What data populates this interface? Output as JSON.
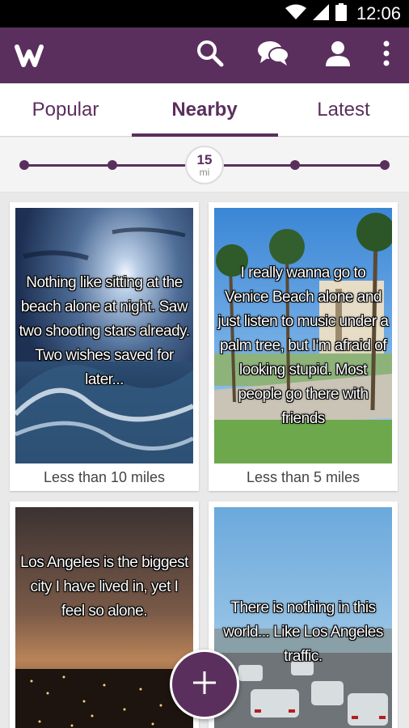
{
  "status_bar": {
    "time": "12:06",
    "icons": [
      "wifi-icon",
      "signal-icon",
      "battery-icon"
    ]
  },
  "app_bar": {
    "logo": "w",
    "actions": [
      "search-icon",
      "chat-icon",
      "profile-icon",
      "more-vert-icon"
    ],
    "color": "#5a2f5d"
  },
  "tabs": [
    {
      "label": "Popular",
      "selected": false
    },
    {
      "label": "Nearby",
      "selected": true
    },
    {
      "label": "Latest",
      "selected": false
    }
  ],
  "distance_slider": {
    "value": "15",
    "unit": "mi",
    "stops": 5,
    "selected_stop": 2
  },
  "cards": [
    {
      "text": "Nothing like sitting at the beach alone at night.  Saw two shooting stars already. Two wishes saved for later...",
      "distance": "Less than 10 miles",
      "image": "night-ocean-wave-painting"
    },
    {
      "text": "I really wanna go to Venice Beach alone and just listen to music under a palm tree, but I'm afraid of looking stupid. Most people go there with friends",
      "distance": "Less than 5 miles",
      "image": "venice-beach-palm-trees"
    },
    {
      "text": "Los Angeles is the biggest city I have lived in, yet I feel so alone.",
      "distance": "",
      "image": "city-lights-at-dusk"
    },
    {
      "text": "There is nothing in this world... Like Los Angeles traffic.",
      "distance": "",
      "image": "freeway-traffic"
    }
  ],
  "fab": {
    "icon": "plus-icon"
  }
}
